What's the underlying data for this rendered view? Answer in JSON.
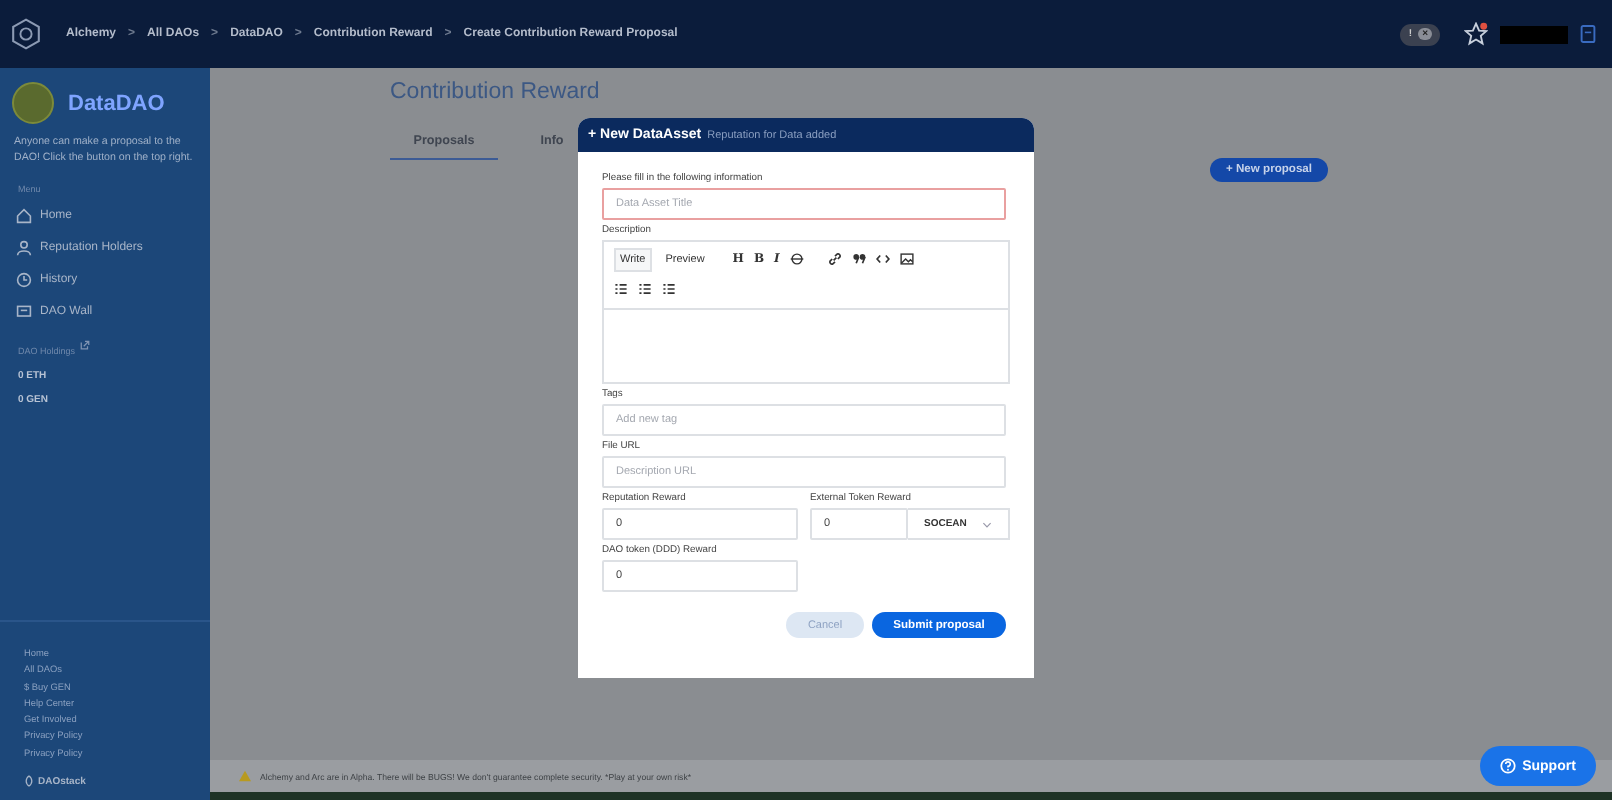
{
  "breadcrumbs": [
    "Alchemy",
    "All DAOs",
    "DataDAO",
    "Contribution Reward",
    "Create Contribution Reward Proposal"
  ],
  "breadcrumb_separator": ">",
  "topbar": {
    "toggle_left": "!",
    "toggle_right": "×",
    "toggle_on": true
  },
  "sidebar": {
    "dao_name": "DataDAO",
    "description": "Anyone can make a proposal to the DAO! Click the button on the top right.",
    "menu_label": "Menu",
    "menu": [
      {
        "kind": "home",
        "label": "Home"
      },
      {
        "kind": "person",
        "label": "Reputation Holders"
      },
      {
        "kind": "history",
        "label": "History"
      },
      {
        "kind": "wall",
        "label": "DAO Wall"
      }
    ],
    "holdings_label": "DAO Holdings",
    "holdings": [
      "0 ETH",
      "0 GEN"
    ],
    "footer_links": [
      "Home",
      "All DAOs",
      "$ Buy GEN",
      "Help Center",
      "Get Involved",
      "Privacy Policy",
      "Privacy Policy"
    ],
    "brand": "DAOstack"
  },
  "main": {
    "title": "Contribution Reward",
    "tabs": [
      {
        "label": "Proposals",
        "selected": true
      },
      {
        "label": "Info",
        "selected": false
      }
    ],
    "new_button": "+ New proposal"
  },
  "modal": {
    "title": "+ New DataAsset",
    "subtitle": "Reputation for Data added",
    "intro": "Please fill in the following information",
    "title_field": {
      "placeholder": "Data Asset Title",
      "invalid": true
    },
    "description_label": "Description",
    "editor_tabs": [
      {
        "label": "Write",
        "selected": true
      },
      {
        "label": "Preview",
        "selected": false
      }
    ],
    "toolbar_letters": [
      "H",
      "B",
      "I"
    ],
    "tags_label": "Tags",
    "tags_placeholder": "Add new tag",
    "url_label": "File URL",
    "url_placeholder": "Description URL",
    "reputation_label": "Reputation Reward",
    "reputation_value": "0",
    "external_label": "External Token Reward",
    "external_value": "0",
    "token": "SOCEAN",
    "dao_token_label": "DAO token (DDD) Reward",
    "dao_token_value": "0",
    "cancel": "Cancel",
    "submit": "Submit proposal"
  },
  "footer": {
    "warning": "Alchemy and Arc are in Alpha. There will be BUGS! We don't guarantee complete security. *Play at your own risk*"
  },
  "support": "Support"
}
